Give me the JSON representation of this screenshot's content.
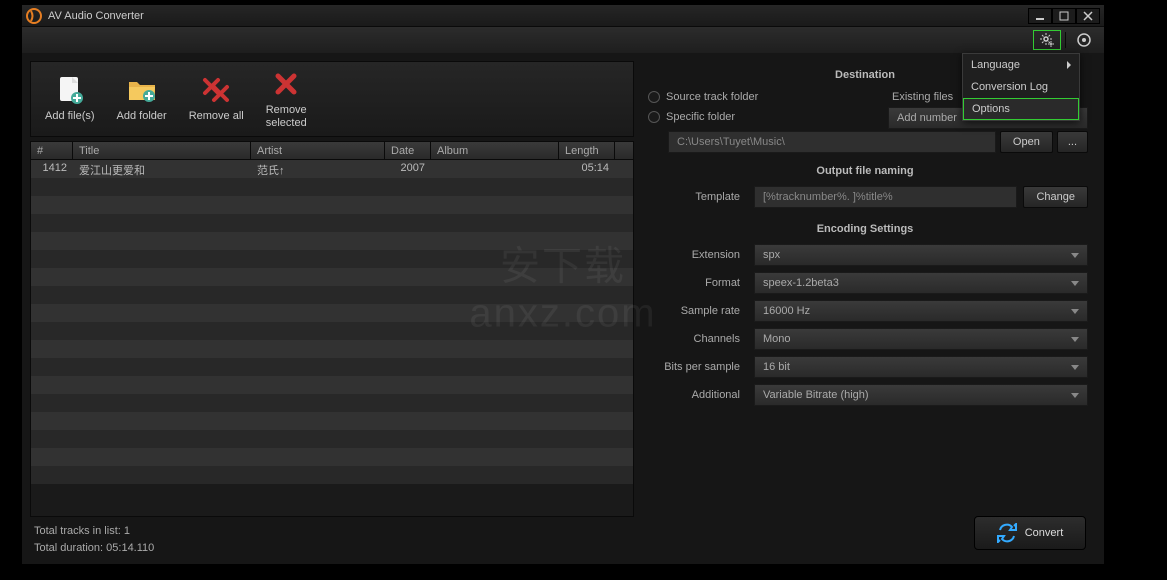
{
  "title": "AV Audio Converter",
  "toolbar": {
    "add_files": "Add file(s)",
    "add_folder": "Add folder",
    "remove_all": "Remove all",
    "remove_selected": "Remove\nselected"
  },
  "grid": {
    "headers": {
      "num": "#",
      "title": "Title",
      "artist": "Artist",
      "date": "Date",
      "album": "Album",
      "length": "Length"
    },
    "rows": [
      {
        "num": "1412",
        "title": "爱江山更爱和",
        "artist": "范氏↑",
        "date": "2007",
        "album": "",
        "length": "05:14"
      }
    ]
  },
  "status": {
    "tracks": "Total tracks in list: 1",
    "duration": "Total duration: 05:14.110"
  },
  "destination": {
    "header": "Destination",
    "source_folder": "Source track folder",
    "specific_folder": "Specific folder",
    "existing_files": "Existing files",
    "existing_value": "Add number",
    "path": "C:\\Users\\Tuyet\\Music\\",
    "open": "Open",
    "browse": "..."
  },
  "naming": {
    "header": "Output file naming",
    "template_label": "Template",
    "template_value": "[%tracknumber%. ]%title%",
    "change": "Change"
  },
  "encoding": {
    "header": "Encoding Settings",
    "extension_label": "Extension",
    "extension_value": "spx",
    "format_label": "Format",
    "format_value": "speex-1.2beta3",
    "samplerate_label": "Sample rate",
    "samplerate_value": "16000 Hz",
    "channels_label": "Channels",
    "channels_value": "Mono",
    "bits_label": "Bits per sample",
    "bits_value": "16 bit",
    "additional_label": "Additional",
    "additional_value": "Variable Bitrate (high)"
  },
  "convert": "Convert",
  "menu": {
    "language": "Language",
    "conversion_log": "Conversion Log",
    "options": "Options"
  },
  "watermark": "安下载\nanxz.com"
}
